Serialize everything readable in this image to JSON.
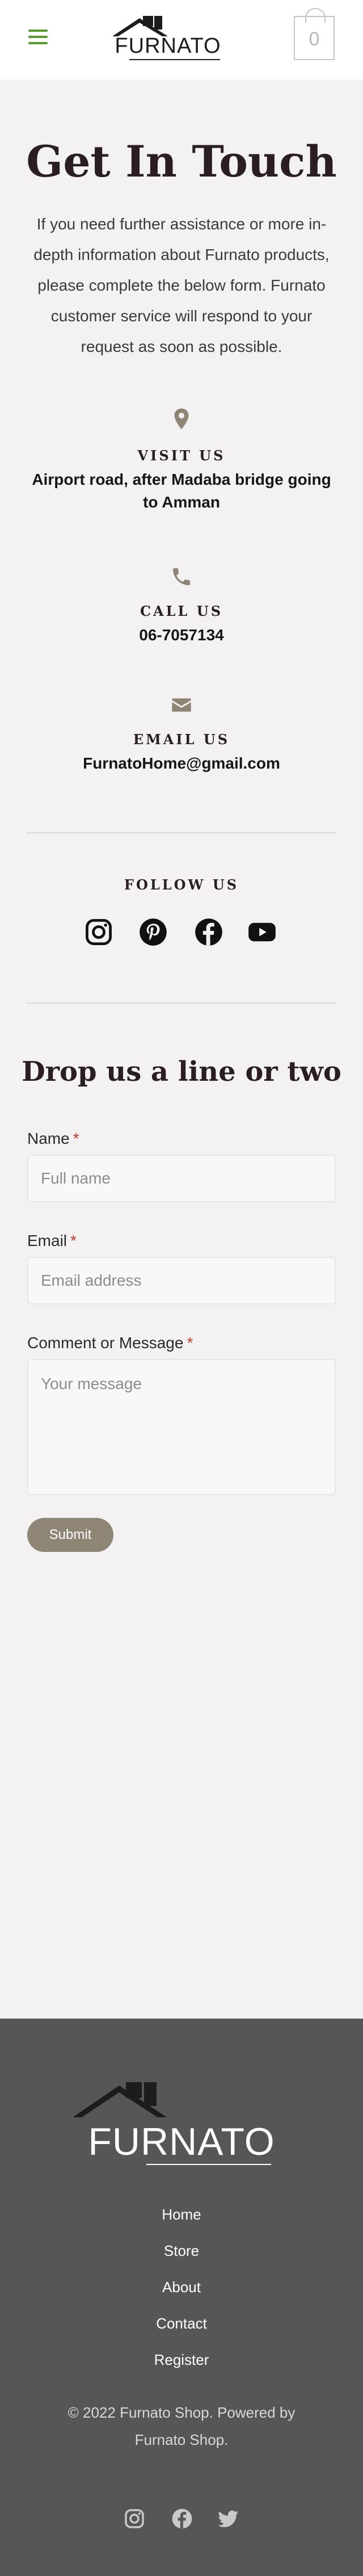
{
  "header": {
    "menu_icon": "hamburger-menu-icon",
    "logo_text": "FURNATO",
    "cart_count": "0",
    "colors": {
      "menu": "#5a9a2c",
      "cart": "#c4c4c4"
    }
  },
  "page": {
    "title": "Get In Touch",
    "intro": "If you need further assistance or more in-depth information about Furnato products, please complete the below form. Furnato customer service will respond to your request as soon as possible."
  },
  "contact": {
    "visit": {
      "icon": "map-pin-icon",
      "label": "VISIT US",
      "value": "Airport road, after Madaba bridge going to Amman"
    },
    "call": {
      "icon": "phone-icon",
      "label": "CALL US",
      "value": "06-7057134"
    },
    "email": {
      "icon": "envelope-icon",
      "label": "EMAIL US",
      "value": "FurnatoHome@gmail.com"
    }
  },
  "follow": {
    "label": "FOLLOW US",
    "icons": [
      "instagram-icon",
      "pinterest-icon",
      "facebook-icon",
      "youtube-icon"
    ]
  },
  "form": {
    "title": "Drop us a line or two",
    "name_label": "Name",
    "name_placeholder": "Full name",
    "email_label": "Email",
    "email_placeholder": "Email address",
    "message_label": "Comment or Message",
    "message_placeholder": "Your message",
    "required_marker": "*",
    "submit_label": "Submit",
    "accent_color": "#8e8575"
  },
  "footer": {
    "logo_text": "FURNATO",
    "links": [
      "Home",
      "Store",
      "About",
      "Contact",
      "Register"
    ],
    "copyright": "© 2022 Furnato Shop. Powered by Furnato Shop.",
    "social_icons": [
      "instagram-icon",
      "facebook-icon",
      "twitter-icon"
    ],
    "background": "#575556"
  }
}
